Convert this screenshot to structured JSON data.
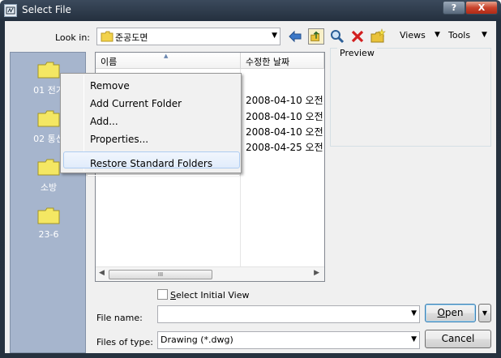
{
  "window": {
    "title": "Select File",
    "help_label": "?",
    "close_label": "X"
  },
  "look_in": {
    "label": "Look in:",
    "value": "준공도면"
  },
  "toolbar": {
    "back_icon": "back-arrow-icon",
    "up_folder_icon": "up-folder-icon",
    "search_web_icon": "search-icon",
    "delete_icon": "delete-icon",
    "new_folder_icon": "new-folder-icon",
    "views_label": "Views",
    "tools_label": "Tools"
  },
  "places": [
    {
      "label": "01 전기"
    },
    {
      "label": "02 통신"
    },
    {
      "label": "소방"
    },
    {
      "label": "23-6"
    }
  ],
  "file_list": {
    "columns": [
      "이름",
      "수정한 날짜"
    ],
    "rows": [
      {
        "date": "2008-04-10 오전"
      },
      {
        "date": "2008-04-10 오전"
      },
      {
        "date": "2008-04-10 오전"
      },
      {
        "date": "2008-04-25 오전"
      }
    ],
    "scroll_grip": "III"
  },
  "preview": {
    "label": "Preview"
  },
  "context_menu": {
    "items": [
      {
        "label": "Remove"
      },
      {
        "label": "Add Current Folder"
      },
      {
        "label": "Add..."
      },
      {
        "label": "Properties..."
      },
      {
        "label": "Restore Standard Folders"
      }
    ],
    "highlighted_index": 3
  },
  "options": {
    "select_initial_view": {
      "label_first": "S",
      "label_rest": "elect Initial View",
      "checked": false
    }
  },
  "file_name": {
    "label": "File name:",
    "value": ""
  },
  "files_of_type": {
    "label": "Files of type:",
    "value": "Drawing (*.dwg)"
  },
  "buttons": {
    "open_first": "O",
    "open_rest": "pen",
    "open_split_arrow": "▼",
    "cancel": "Cancel"
  },
  "colors": {
    "places_bg": "#a6b5cd",
    "folder_yellow": "#f4e763",
    "highlight_border": "#aeccf1",
    "delete_red": "#d21f1f"
  }
}
